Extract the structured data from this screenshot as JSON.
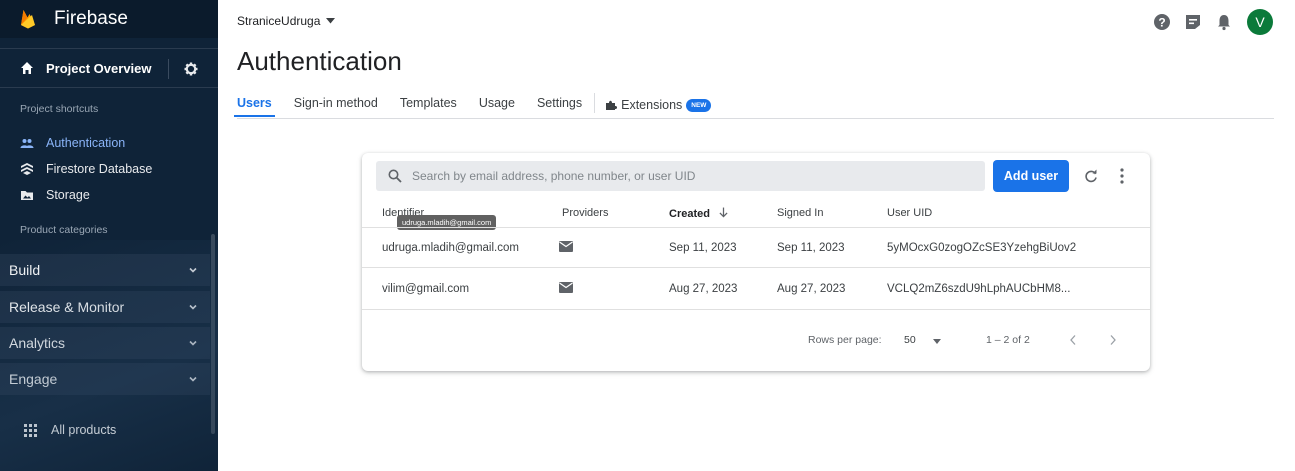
{
  "sidebar": {
    "brand": "Firebase",
    "project_overview": "Project Overview",
    "shortcuts_title": "Project shortcuts",
    "shortcuts": [
      {
        "label": "Authentication",
        "icon": "people-icon"
      },
      {
        "label": "Firestore Database",
        "icon": "firestore-icon"
      },
      {
        "label": "Storage",
        "icon": "storage-icon"
      }
    ],
    "categories_title": "Product categories",
    "categories": [
      "Build",
      "Release & Monitor",
      "Analytics",
      "Engage"
    ],
    "all_products": "All products"
  },
  "header": {
    "project_name": "StraniceUdruga",
    "avatar_letter": "V",
    "title": "Authentication"
  },
  "tabs": {
    "items": [
      "Users",
      "Sign-in method",
      "Templates",
      "Usage",
      "Settings"
    ],
    "extensions": "Extensions",
    "new_badge": "NEW"
  },
  "users": {
    "search_placeholder": "Search by email address, phone number, or user UID",
    "add_user": "Add user",
    "columns": [
      "Identifier",
      "Providers",
      "Created",
      "Signed In",
      "User UID"
    ],
    "tooltip": "udruga.mladih@gmail.com",
    "rows": [
      {
        "identifier": "udruga.mladih@gmail.com",
        "provider": "email",
        "created": "Sep 11, 2023",
        "signed_in": "Sep 11, 2023",
        "uid": "5yMOcxG0zogOZcSE3YzehgBiUov2"
      },
      {
        "identifier": "vilim@gmail.com",
        "provider": "email",
        "created": "Aug 27, 2023",
        "signed_in": "Aug 27, 2023",
        "uid": "VCLQ2mZ6szdU9hLphAUCbHM8..."
      }
    ],
    "rows_per_page_label": "Rows per page:",
    "rows_per_page": "50",
    "range": "1 – 2 of 2"
  },
  "colors": {
    "sidebar_bg": "#0f2338",
    "accent": "#1a73e8",
    "avatar": "#0b7a3a"
  }
}
